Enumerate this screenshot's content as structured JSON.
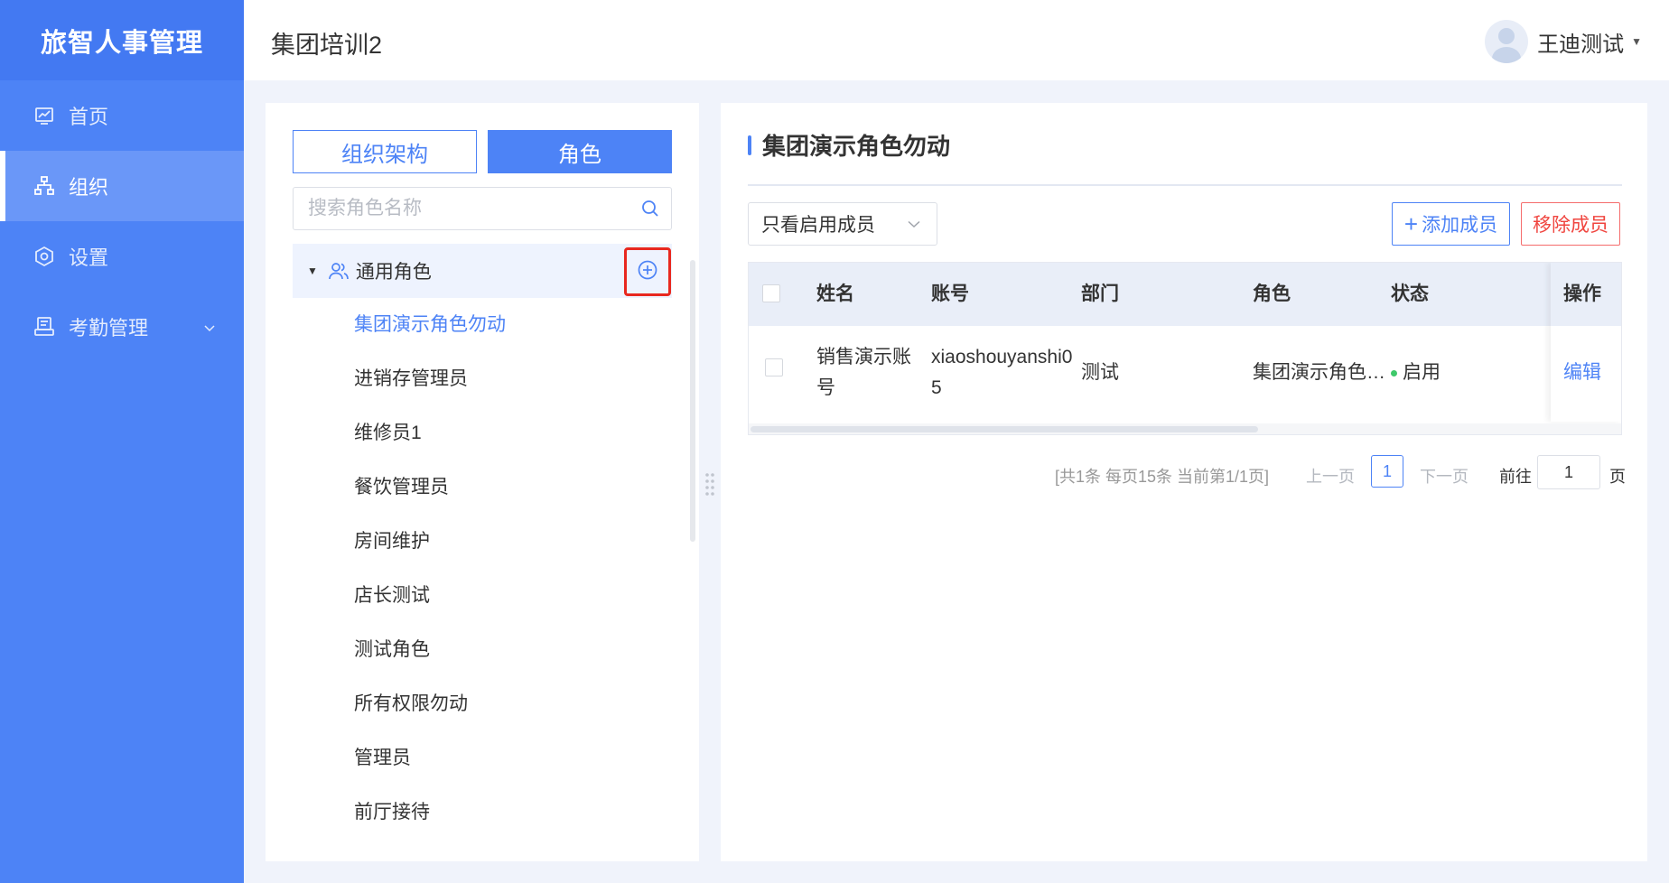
{
  "app": {
    "brand": "旅智人事管理"
  },
  "header": {
    "title": "集团培训2",
    "user_name": "王迪测试"
  },
  "sidebar": {
    "items": [
      {
        "label": "首页",
        "icon": "dashboard-icon",
        "active": false
      },
      {
        "label": "组织",
        "icon": "org-chart-icon",
        "active": true
      },
      {
        "label": "设置",
        "icon": "settings-icon",
        "active": false
      },
      {
        "label": "考勤管理",
        "icon": "attendance-icon",
        "active": false,
        "expandable": true
      }
    ]
  },
  "left_panel": {
    "tabs": {
      "org": "组织架构",
      "role": "角色"
    },
    "search": {
      "placeholder": "搜索角色名称",
      "value": ""
    },
    "tree_root": {
      "label": "通用角色"
    },
    "roles": [
      "集团演示角色勿动",
      "进销存管理员",
      "维修员1",
      "餐饮管理员",
      "房间维护",
      "店长测试",
      "测试角色",
      "所有权限勿动",
      "管理员",
      "前厅接待"
    ],
    "selected_role_index": 0
  },
  "right_panel": {
    "title": "集团演示角色勿动",
    "filter": {
      "value": "只看启用成员"
    },
    "buttons": {
      "add": "添加成员",
      "remove": "移除成员"
    },
    "table": {
      "columns": [
        "姓名",
        "账号",
        "部门",
        "角色",
        "状态",
        "操作"
      ],
      "rows": [
        {
          "name_line1": "销售演示账",
          "name_line2": "号",
          "account_line1": "xiaoshouyanshi0",
          "account_line2": "5",
          "department": "测试",
          "role": "集团演示角色…",
          "status": "启用",
          "action": "编辑"
        }
      ]
    },
    "pagination": {
      "summary": "[共1条 每页15条 当前第1/1页]",
      "prev": "上一页",
      "current_page": "1",
      "next": "下一页",
      "goto_label": "前往",
      "goto_value": "1",
      "page_suffix": "页"
    }
  },
  "colors": {
    "primary": "#4d83f6",
    "danger": "#f0453f",
    "status_active": "#3ec96a",
    "highlight_box": "#e8281f"
  }
}
